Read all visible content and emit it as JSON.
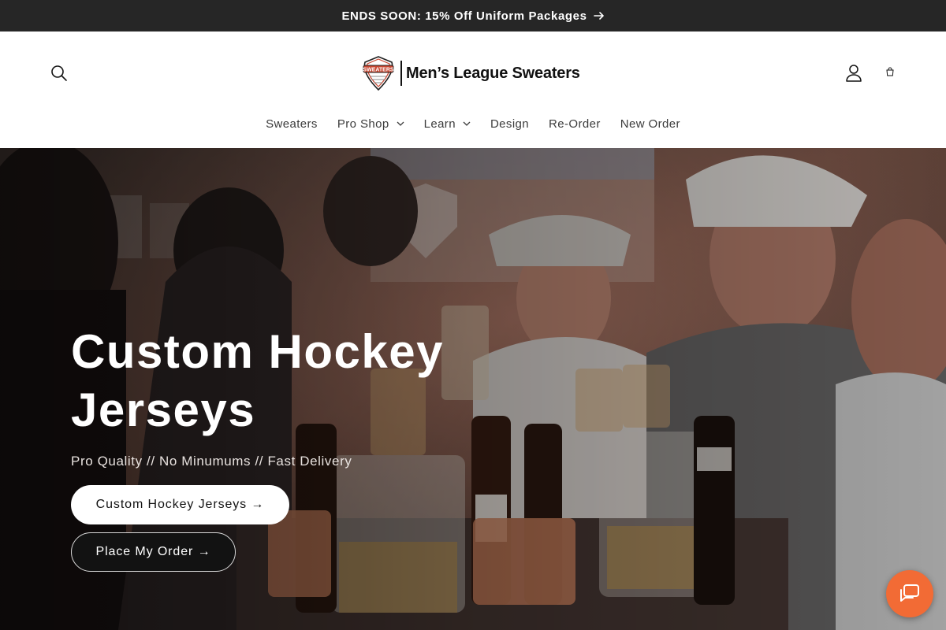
{
  "announcement": {
    "text": "ENDS SOON: 15% Off Uniform Packages",
    "arrow_icon": "arrow-right-icon"
  },
  "header": {
    "brand_name": "Men’s League Sweaters",
    "logo_badge_text": "SWEATERS",
    "search_icon": "search-icon",
    "account_icon": "account-icon",
    "cart_icon": "cart-icon"
  },
  "nav": {
    "items": [
      {
        "label": "Sweaters",
        "has_dropdown": false
      },
      {
        "label": "Pro Shop",
        "has_dropdown": true
      },
      {
        "label": "Learn",
        "has_dropdown": true
      },
      {
        "label": "Design",
        "has_dropdown": false
      },
      {
        "label": "Re-Order",
        "has_dropdown": false
      },
      {
        "label": "New Order",
        "has_dropdown": false
      }
    ]
  },
  "hero": {
    "title": "Custom Hockey Jerseys",
    "subtitle": "Pro Quality // No Minumums // Fast Delivery",
    "primary_button": "Custom Hockey Jerseys →",
    "secondary_button": "Place My Order →"
  },
  "chat": {
    "icon": "chat-icon"
  },
  "colors": {
    "announcement_bg": "#262626",
    "chat_accent": "#f26b35",
    "text_dark": "#121212"
  }
}
